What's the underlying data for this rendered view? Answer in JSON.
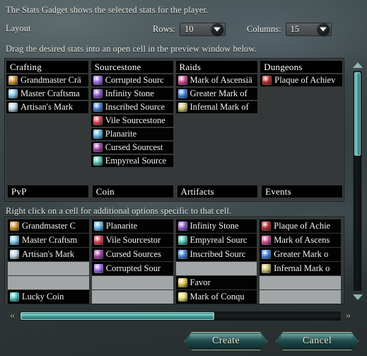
{
  "descriptions": {
    "top": "The Stats Gadget shows the selected stats for the player.",
    "drag": "Drag the desired stats into an open cell in the preview window below.",
    "rightclick": "Right click on a cell for additional options specific to that cell."
  },
  "layout": {
    "label": "Layout",
    "rows": {
      "label": "Rows:",
      "value": "10"
    },
    "columns": {
      "label": "Columns:",
      "value": "15"
    }
  },
  "list_panel": {
    "columns": [
      {
        "header": "Crafting",
        "items": [
          {
            "label": "Grandmaster Crä",
            "color": "#c8922e"
          },
          {
            "label": "Master Craftsma",
            "color": "#7fc7e8"
          },
          {
            "label": "Artisan's Mark",
            "color": "#bcd2e0"
          }
        ]
      },
      {
        "header": "Sourcestone",
        "items": [
          {
            "label": "Corrupted Sourc",
            "color": "#9a63e8"
          },
          {
            "label": "Infinity Stone",
            "color": "#8b56c8"
          },
          {
            "label": "Inscribed Source",
            "color": "#3f7fd0"
          },
          {
            "label": "Vile Sourcestone",
            "color": "#d93c4e"
          },
          {
            "label": "Planarite",
            "color": "#5fb6e8"
          },
          {
            "label": "Cursed Sourcest",
            "color": "#a13fa8"
          },
          {
            "label": "Empyreal Source",
            "color": "#4fc2b0"
          }
        ]
      },
      {
        "header": "Raids",
        "items": [
          {
            "label": "Mark of Ascensiä",
            "color": "#d24a8c"
          },
          {
            "label": "Greater Mark of",
            "color": "#3c7fd8"
          },
          {
            "label": "Infernal Mark of",
            "color": "#c8bd6a"
          }
        ]
      },
      {
        "header": "Dungeons",
        "items": [
          {
            "label": "Plaque of Achiev",
            "color": "#b42a2a"
          }
        ]
      }
    ],
    "footer_headers": [
      "PvP",
      "Coin",
      "Artifacts",
      "Events"
    ]
  },
  "preview": {
    "columns": [
      {
        "cells": [
          {
            "label": "Grandmaster C",
            "color": "#c8922e",
            "state": "filled"
          },
          {
            "label": "Master Craftsm",
            "color": "#7fc7e8",
            "state": "filled"
          },
          {
            "label": "Artisan's Mark",
            "color": "#bcd2e0",
            "state": "filled"
          },
          {
            "label": "",
            "color": "",
            "state": "blank"
          },
          {
            "label": "",
            "color": "",
            "state": "blank"
          },
          {
            "label": "Lucky Coin",
            "color": "#49c0bd",
            "state": "filled"
          }
        ]
      },
      {
        "cells": [
          {
            "label": "Planarite",
            "color": "#5fb6e8",
            "state": "filled"
          },
          {
            "label": "Vile Sourcestor",
            "color": "#d93c4e",
            "state": "filled"
          },
          {
            "label": "Cursed Sources",
            "color": "#a13fa8",
            "state": "filled"
          },
          {
            "label": "Corrupted Sour",
            "color": "#9a63e8",
            "state": "filled"
          },
          {
            "label": "",
            "color": "",
            "state": "blank"
          },
          {
            "label": "",
            "color": "",
            "state": "blank"
          }
        ]
      },
      {
        "cells": [
          {
            "label": "Infinity Stone",
            "color": "#8b56c8",
            "state": "filled"
          },
          {
            "label": "Empyreal Sourc",
            "color": "#4fc2b0",
            "state": "filled"
          },
          {
            "label": "Inscribed Sourc",
            "color": "#3f7fd0",
            "state": "filled"
          },
          {
            "label": "",
            "color": "",
            "state": "blank"
          },
          {
            "label": "Favor",
            "color": "#d8c24a",
            "state": "filled"
          },
          {
            "label": "Mark of Conqu",
            "color": "#e2d86a",
            "state": "filled"
          }
        ]
      },
      {
        "cells": [
          {
            "label": "Plaque of Achie",
            "color": "#b42a2a",
            "state": "filled"
          },
          {
            "label": "Mark of Ascens",
            "color": "#d24a8c",
            "state": "filled"
          },
          {
            "label": "Greater Mark o",
            "color": "#3c7fd8",
            "state": "filled"
          },
          {
            "label": "Infernal Mark o",
            "color": "#c8bd6a",
            "state": "filled"
          },
          {
            "label": "",
            "color": "",
            "state": "blank"
          },
          {
            "label": "",
            "color": "",
            "state": "blank"
          }
        ]
      }
    ]
  },
  "scrollbars": {
    "vertical": {
      "up_icon": "chevron-up-icon",
      "down_icon": "chevron-down-icon"
    },
    "horizontal": {
      "left_icon": "chevron-left-icon",
      "right_icon": "chevron-right-icon",
      "left_glyph": "«",
      "right_glyph": "»"
    }
  },
  "buttons": {
    "create": "Create",
    "cancel": "Cancel"
  },
  "colors": {
    "accent_teal": "#3f9a98",
    "button_gold": "#b9a87e",
    "panel_bg": "#343838",
    "cell_bg": "#030303",
    "blank_cell": "#a3a6a6"
  }
}
